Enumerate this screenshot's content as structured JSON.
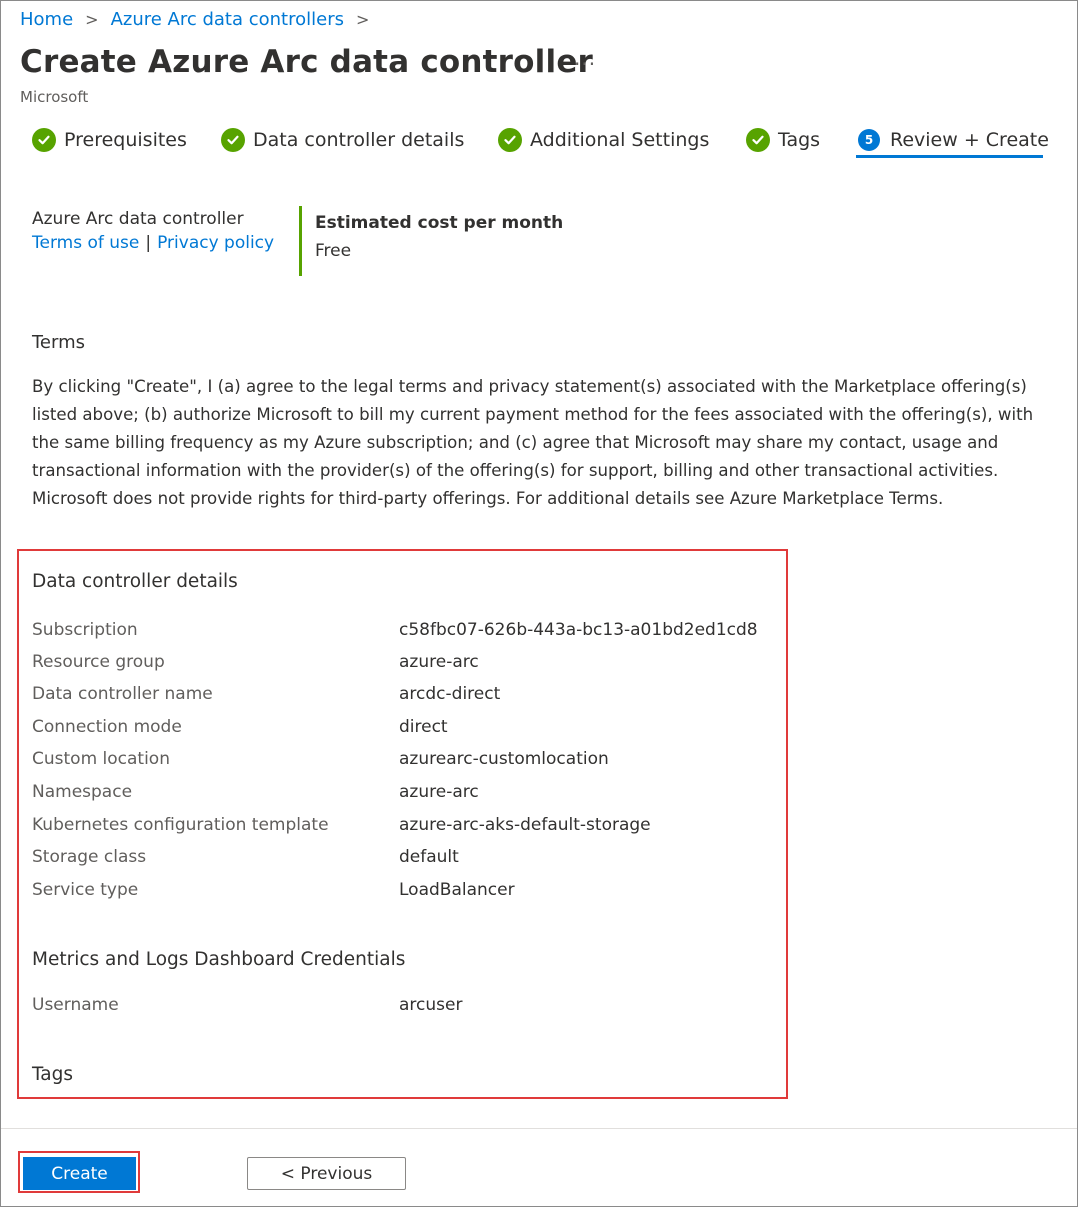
{
  "breadcrumb": {
    "home": "Home",
    "parent": "Azure Arc data controllers"
  },
  "page": {
    "title": "Create Azure Arc data controller",
    "more": "···",
    "publisher": "Microsoft"
  },
  "tabs": [
    {
      "label": "Prerequisites",
      "state": "complete"
    },
    {
      "label": "Data controller details",
      "state": "complete"
    },
    {
      "label": "Additional Settings",
      "state": "complete"
    },
    {
      "label": "Tags",
      "state": "complete"
    },
    {
      "label": "Review + Create",
      "state": "active",
      "step": "5"
    }
  ],
  "offer": {
    "name": "Azure Arc data controller",
    "terms_link": "Terms of use",
    "separator": "|",
    "privacy_link": "Privacy policy"
  },
  "cost": {
    "label": "Estimated cost per month",
    "value": "Free"
  },
  "terms": {
    "heading": "Terms",
    "body": "By clicking \"Create\", I (a) agree to the legal terms and privacy statement(s) associated with the Marketplace offering(s) listed above; (b) authorize Microsoft to bill my current payment method for the fees associated with the offering(s), with the same billing frequency as my Azure subscription; and (c) agree that Microsoft may share my contact, usage and transactional information with the provider(s) of the offering(s) for support, billing and other transactional activities. Microsoft does not provide rights for third-party offerings. For additional details see Azure Marketplace Terms."
  },
  "details": {
    "heading": "Data controller details",
    "rows": [
      {
        "key": "Subscription",
        "value": "c58fbc07-626b-443a-bc13-a01bd2ed1cd8"
      },
      {
        "key": "Resource group",
        "value": "azure-arc"
      },
      {
        "key": "Data controller name",
        "value": "arcdc-direct"
      },
      {
        "key": "Connection mode",
        "value": "direct"
      },
      {
        "key": "Custom location",
        "value": "azurearc-customlocation"
      },
      {
        "key": "Namespace",
        "value": "azure-arc"
      },
      {
        "key": "Kubernetes configuration template",
        "value": "azure-arc-aks-default-storage"
      },
      {
        "key": "Storage class",
        "value": "default"
      },
      {
        "key": "Service type",
        "value": "LoadBalancer"
      }
    ]
  },
  "credentials": {
    "heading": "Metrics and Logs Dashboard Credentials",
    "rows": [
      {
        "key": "Username",
        "value": "arcuser"
      }
    ]
  },
  "tags": {
    "heading": "Tags"
  },
  "footer": {
    "create_label": "Create",
    "previous_label": "< Previous"
  },
  "colors": {
    "accent": "#0078d4",
    "success": "#57a300",
    "highlight": "#e03a3a"
  },
  "icons": {
    "complete": "checkmark-circle-icon",
    "breadcrumb_separator": "chevron-right-icon"
  }
}
